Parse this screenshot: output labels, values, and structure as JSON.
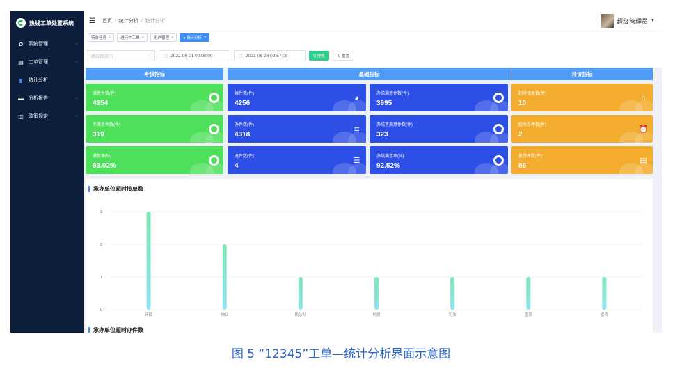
{
  "app": {
    "title": "热线工单处置系统"
  },
  "sidebar": {
    "items": [
      {
        "label": "系统管理",
        "icon": "gear-icon",
        "glyph": "✿"
      },
      {
        "label": "工单管理",
        "icon": "document-icon",
        "glyph": "▤"
      },
      {
        "label": "统计分析",
        "icon": "bar-chart-icon",
        "glyph": "▮"
      },
      {
        "label": "分析报告",
        "icon": "folder-icon",
        "glyph": "▬"
      },
      {
        "label": "政策规定",
        "icon": "book-icon",
        "glyph": "◫"
      }
    ]
  },
  "header": {
    "breadcrumb": [
      "首页",
      "统计分析",
      "统计分析"
    ],
    "user": "超级管理员"
  },
  "tags": [
    {
      "label": "待办任务",
      "active": false
    },
    {
      "label": "进行中工单",
      "active": false
    },
    {
      "label": "用户管理",
      "active": false
    },
    {
      "label": "● 统计分析",
      "active": true
    }
  ],
  "filter": {
    "dept_placeholder": "请选择部门",
    "start_time": "2022-06-01 00:00:00",
    "end_time": "2023-06-28 09:57:08",
    "search_label": "Q 搜索",
    "reset_label": "↻ 重置"
  },
  "sections": {
    "assess": "考核指标",
    "basic": "基础指标",
    "eval": "评价指标"
  },
  "cards": [
    {
      "label": "满意件数(件)",
      "value": "4254",
      "color": "green",
      "icon": "thumbs-up-icon"
    },
    {
      "label": "接件数(件)",
      "value": "4256",
      "color": "blue",
      "icon": "pie-chart-icon"
    },
    {
      "label": "办结满意件数(件)",
      "value": "3995",
      "color": "blue",
      "icon": "thumbs-up-icon"
    },
    {
      "label": "超时接单数(件)",
      "value": "10",
      "color": "orange",
      "icon": "home-clock-icon"
    },
    {
      "label": "不满意件数(件)",
      "value": "319",
      "color": "green",
      "icon": "thumbs-down-icon"
    },
    {
      "label": "办件数(件)",
      "value": "4318",
      "color": "blue",
      "icon": "layers-icon"
    },
    {
      "label": "办结不满意件数(件)",
      "value": "323",
      "color": "blue",
      "icon": "thumbs-down-icon"
    },
    {
      "label": "超时办件数(件)",
      "value": "2",
      "color": "orange",
      "icon": "alarm-clock-icon"
    },
    {
      "label": "满意率(%)",
      "value": "93.02%",
      "color": "green",
      "icon": "thumbs-up-icon"
    },
    {
      "label": "退件数(件)",
      "value": "4",
      "color": "blue",
      "icon": "server-icon"
    },
    {
      "label": "办结满意率(%)",
      "value": "92.52%",
      "color": "blue",
      "icon": "thumbs-up-icon"
    },
    {
      "label": "复办件数(件)",
      "value": "86",
      "color": "orange",
      "icon": "clipboard-icon"
    }
  ],
  "chart_data": {
    "type": "bar",
    "title": "承办单位超时接单数",
    "categories": [
      "环保",
      "物业",
      "执法队",
      "村居",
      "司法",
      "国资",
      "农资"
    ],
    "values": [
      3,
      2,
      1,
      1,
      1,
      1,
      1
    ],
    "yticks": [
      0,
      1,
      2,
      3
    ],
    "ylim": [
      0,
      3
    ],
    "grid": true,
    "bar_gradient": [
      "#7ee8b4",
      "#8fe3f0"
    ]
  },
  "next_section_title": "承办单位超时办件数",
  "caption": "图 5 “12345”工单—统计分析界面示意图"
}
